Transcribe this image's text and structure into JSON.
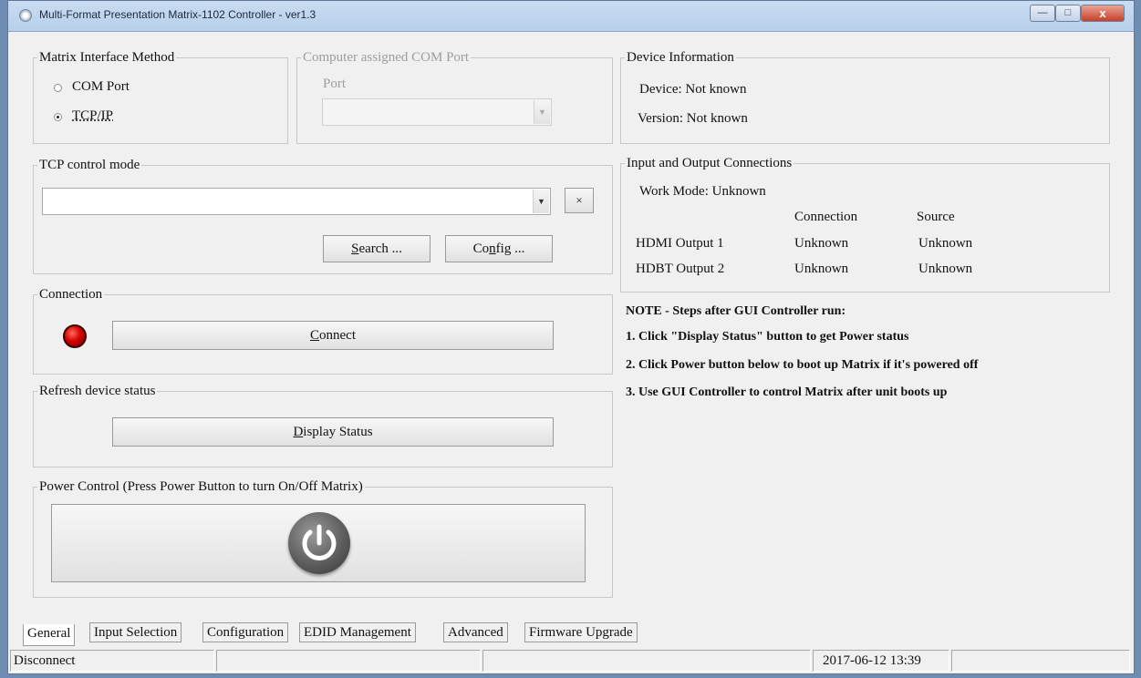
{
  "window": {
    "title": "Multi-Format Presentation Matrix-1102 Controller - ver1.3",
    "minimize": "—",
    "maximize": "□",
    "close": "x"
  },
  "interface_method": {
    "label": "Matrix Interface Method",
    "options": [
      "COM Port",
      "TCP/IP"
    ],
    "selected": "TCP/IP"
  },
  "com_port": {
    "label": "Computer assigned COM Port",
    "port_label": "Port",
    "value": ""
  },
  "tcp": {
    "label": "TCP control mode",
    "value": "",
    "clear": "×",
    "search_pre": "",
    "search_u": "S",
    "search_post": "earch ...",
    "config_pre": "Co",
    "config_u": "n",
    "config_post": "fig ..."
  },
  "connection": {
    "label": "Connection",
    "button_u": "C",
    "button_post": "onnect",
    "led_color": "#d60000"
  },
  "refresh": {
    "label": "Refresh device status",
    "button_u": "D",
    "button_post": "isplay Status"
  },
  "power": {
    "label": "Power Control (Press Power Button to turn On/Off Matrix)",
    "icon": "power-icon"
  },
  "device_info": {
    "label": "Device Information",
    "device": "Device: Not known",
    "version": "Version: Not known"
  },
  "io": {
    "label": "Input and Output Connections",
    "work_mode": "Work Mode: Unknown",
    "headers": [
      "Connection",
      "Source"
    ],
    "rows": [
      {
        "name": "HDMI Output 1",
        "connection": "Unknown",
        "source": "Unknown"
      },
      {
        "name": "HDBT Output 2",
        "connection": "Unknown",
        "source": "Unknown"
      }
    ]
  },
  "notes": [
    "NOTE - Steps after GUI Controller run:",
    "1. Click \"Display Status\" button to get Power status",
    "2. Click Power button below to boot up Matrix if it's powered off",
    "3. Use GUI Controller to control Matrix after unit boots up"
  ],
  "tabs": [
    "General",
    "Input Selection",
    "Configuration",
    "EDID Management",
    "Advanced",
    "Firmware Upgrade"
  ],
  "status": {
    "text": "Disconnect",
    "datetime": "2017-06-12 13:39"
  }
}
